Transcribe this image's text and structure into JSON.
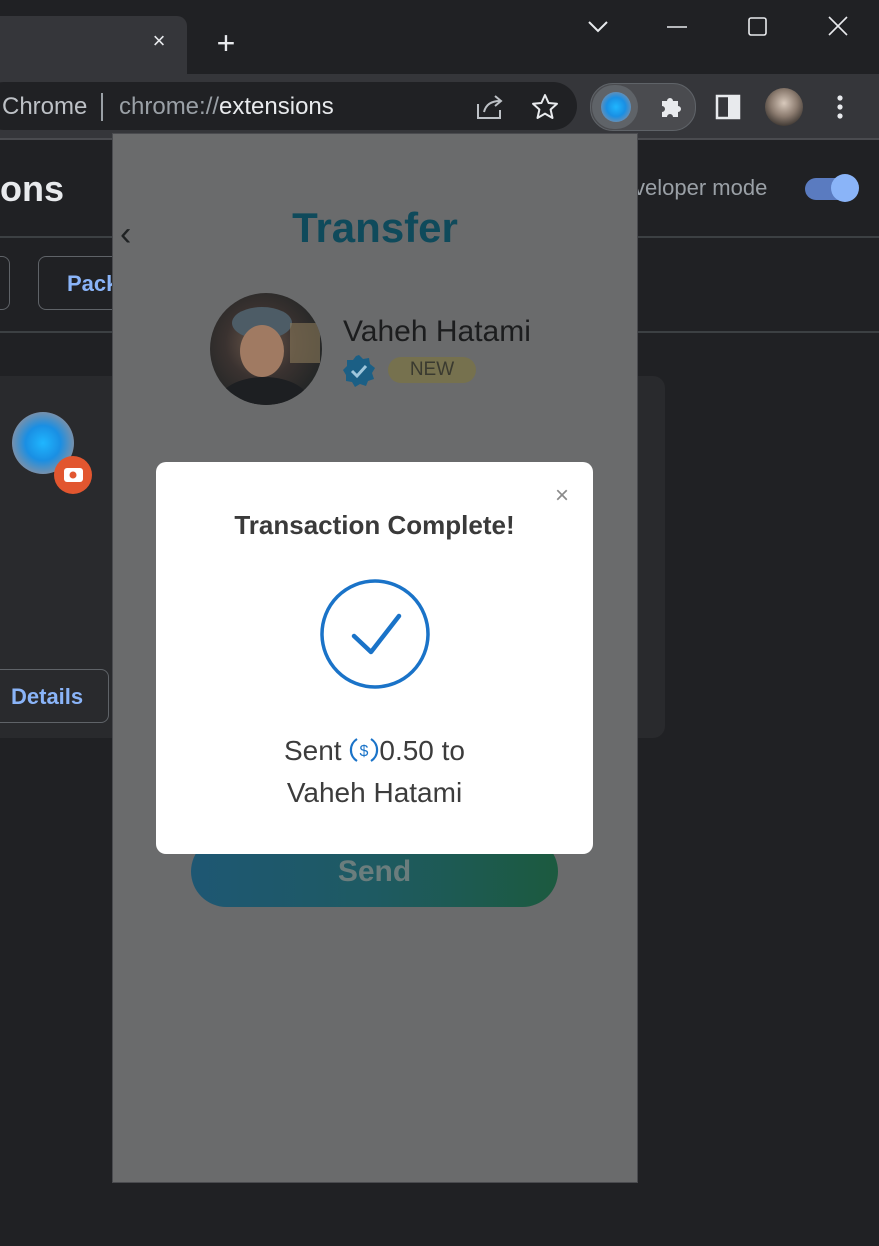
{
  "browser": {
    "omnibox_site": "Chrome",
    "omnibox_url_scheme": "chrome://",
    "omnibox_url_path": "extensions",
    "tab_close": "×",
    "new_tab": "+"
  },
  "extensions_page": {
    "title_partial": "ons",
    "developer_mode_label": "veloper mode",
    "developer_mode_on": true,
    "pack_button_partial": "Pack",
    "details_button": "Details"
  },
  "popup": {
    "back": "‹",
    "title": "Transfer",
    "recipient_name": "Vaheh Hatami",
    "recipient_badge": "NEW",
    "send_button": "Send"
  },
  "modal": {
    "close": "×",
    "title": "Transaction Complete!",
    "sent_prefix": "Sent",
    "amount": "0.50",
    "sent_suffix": "to",
    "recipient": "Vaheh Hatami"
  },
  "colors": {
    "accent_blue": "#1a73c8",
    "link_blue": "#8ab4f8",
    "popup_title": "#0f4a5b"
  },
  "icons": [
    "close-icon",
    "plus-icon",
    "chevron-down-icon",
    "minimize-icon",
    "maximize-icon",
    "window-close-icon",
    "share-icon",
    "star-icon",
    "puzzle-icon",
    "side-panel-icon",
    "more-vert-icon",
    "verified-icon",
    "check-circle-icon",
    "coin-icon"
  ]
}
